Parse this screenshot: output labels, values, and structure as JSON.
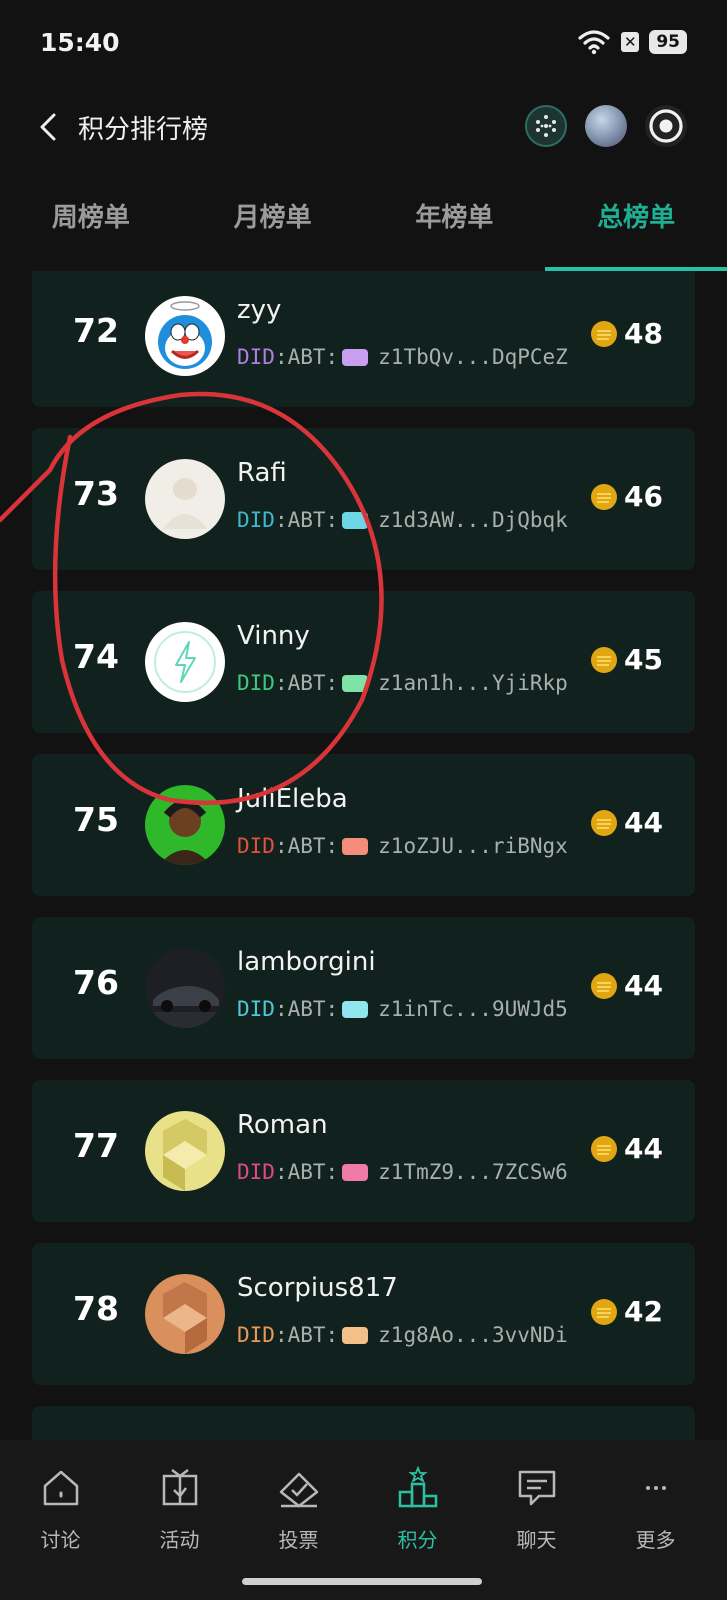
{
  "status_bar": {
    "time": "15:40",
    "battery": "95",
    "icons": [
      "wifi-icon",
      "x-notification-icon",
      "battery-icon"
    ]
  },
  "header": {
    "title": "积分排行榜",
    "back_icon": "chevron-left-icon"
  },
  "tabs": [
    {
      "label": "周榜单",
      "active": false
    },
    {
      "label": "月榜单",
      "active": false
    },
    {
      "label": "年榜单",
      "active": false
    },
    {
      "label": "总榜单",
      "active": true
    }
  ],
  "ranking": [
    {
      "rank": "72",
      "name": "zyy",
      "did_prefix": "DID",
      "did_mid": ":ABT:",
      "did_value": "z1TbQv...DqPCeZ",
      "score": "48",
      "did_color": "#b07ee0",
      "gem_color": "#c79ef0"
    },
    {
      "rank": "73",
      "name": "Rafi",
      "did_prefix": "DID",
      "did_mid": ":ABT:",
      "did_value": "z1d3AW...DjQbqk",
      "score": "46",
      "did_color": "#3fb8cf",
      "gem_color": "#6fd6e6"
    },
    {
      "rank": "74",
      "name": "Vinny",
      "did_prefix": "DID",
      "did_mid": ":ABT:",
      "did_value": "z1an1h...YjiRkp",
      "score": "45",
      "did_color": "#3fc97a",
      "gem_color": "#7fe3a8"
    },
    {
      "rank": "75",
      "name": "JuliEleba",
      "did_prefix": "DID",
      "did_mid": ":ABT:",
      "did_value": "z1oZJU...riBNgx",
      "score": "44",
      "did_color": "#e0523e",
      "gem_color": "#f58c7c"
    },
    {
      "rank": "76",
      "name": "lamborgini",
      "did_prefix": "DID",
      "did_mid": ":ABT:",
      "did_value": "z1inTc...9UWJd5",
      "score": "44",
      "did_color": "#4fc8d6",
      "gem_color": "#8fe6ee"
    },
    {
      "rank": "77",
      "name": "Roman",
      "did_prefix": "DID",
      "did_mid": ":ABT:",
      "did_value": "z1TmZ9...7ZCSw6",
      "score": "44",
      "did_color": "#e04a82",
      "gem_color": "#f07aa8"
    },
    {
      "rank": "78",
      "name": "Scorpius817",
      "did_prefix": "DID",
      "did_mid": ":ABT:",
      "did_value": "z1g8Ao...3vvNDi",
      "score": "42",
      "did_color": "#e89a55",
      "gem_color": "#f4c08a"
    }
  ],
  "bottom_nav": [
    {
      "label": "讨论",
      "icon": "home-icon",
      "active": false
    },
    {
      "label": "活动",
      "icon": "gift-icon",
      "active": false
    },
    {
      "label": "投票",
      "icon": "vote-box-icon",
      "active": false
    },
    {
      "label": "积分",
      "icon": "podium-icon",
      "active": true
    },
    {
      "label": "聊天",
      "icon": "chat-bubble-icon",
      "active": false
    },
    {
      "label": "更多",
      "icon": "more-dots-icon",
      "active": false
    }
  ],
  "colors": {
    "accent": "#26c2a5",
    "card_bg": "#11211e",
    "page_bg": "#121212",
    "annotation": "#d9343a"
  }
}
